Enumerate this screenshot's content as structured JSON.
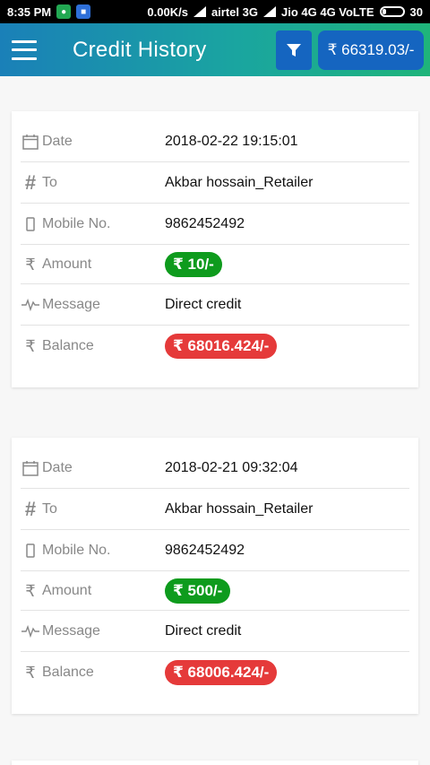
{
  "status_bar": {
    "time": "8:35 PM",
    "net_speed": "0.00K/s",
    "carrier1": "airtel 3G",
    "carrier2": "Jio 4G 4G VoLTE",
    "battery": "30"
  },
  "header": {
    "title": "Credit History",
    "balance": "₹ 66319.03/-"
  },
  "labels": {
    "date": "Date",
    "to": "To",
    "mobile": "Mobile No.",
    "amount": "Amount",
    "message": "Message",
    "balance": "Balance"
  },
  "records": [
    {
      "date": "2018-02-22 19:15:01",
      "to": "Akbar hossain_Retailer",
      "mobile": "9862452492",
      "amount": "₹ 10/-",
      "message": "Direct credit",
      "balance": "₹ 68016.424/-"
    },
    {
      "date": "2018-02-21 09:32:04",
      "to": "Akbar hossain_Retailer",
      "mobile": "9862452492",
      "amount": "₹ 500/-",
      "message": "Direct credit",
      "balance": "₹ 68006.424/-"
    }
  ],
  "colors": {
    "amount_badge": "#0e9b1d",
    "balance_badge": "#e53a3a",
    "button": "#1565c0"
  }
}
